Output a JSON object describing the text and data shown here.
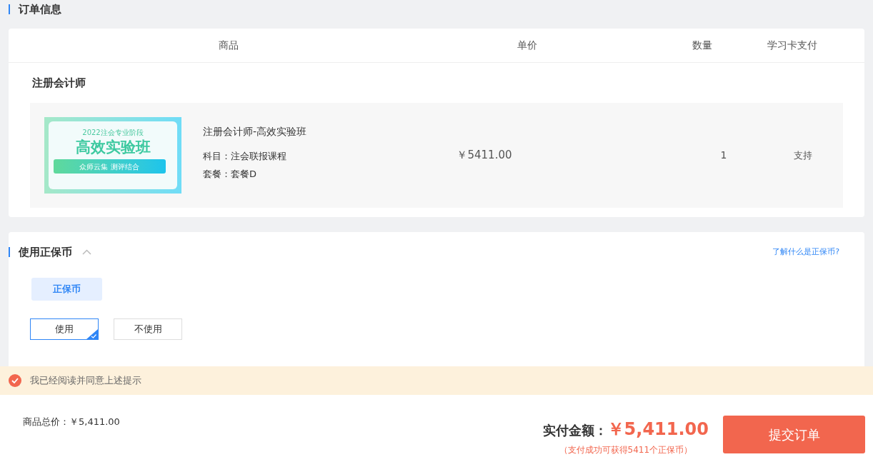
{
  "order_section": {
    "title": "订单信息",
    "columns": [
      "商品",
      "单价",
      "数量",
      "学习卡支付"
    ],
    "groups": [
      {
        "title": "注册会计师",
        "items": [
          {
            "banner": {
              "year_line": "2022注会专业阶段",
              "headline": "高效实验班",
              "ribbon": "众师云集 测评结合"
            },
            "name": "注册会计师-高效实验班",
            "subject": "科目：注会联报课程",
            "package": "套餐：套餐D",
            "price": "￥5411.00",
            "quantity": "1",
            "study_card": "支持"
          }
        ]
      }
    ]
  },
  "coin_section": {
    "title": "使用正保币",
    "expanded": true,
    "help_link": "了解什么是正保币?",
    "tabs": [
      {
        "label": "正保币",
        "selected": true
      }
    ],
    "options": [
      {
        "label": "使用",
        "selected": true
      },
      {
        "label": "不使用",
        "selected": false
      }
    ]
  },
  "agreement": {
    "checked": true,
    "text": "我已经阅读并同意上述提示"
  },
  "footer": {
    "total": "商品总价：￥5,411.00",
    "pay_label": "实付金额：",
    "pay_amount": "￥5,411.00",
    "reward_note": "（支付成功可获得5411个正保币）",
    "submit": "提交订单"
  }
}
